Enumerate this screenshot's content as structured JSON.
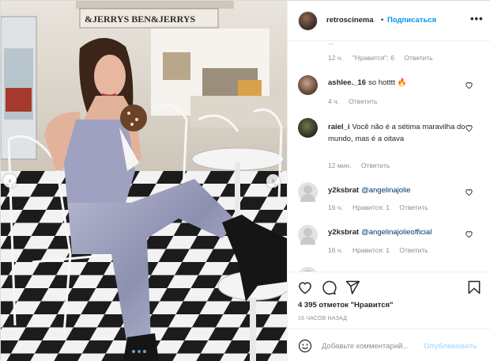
{
  "post": {
    "username": "retroscinema",
    "bullet": "•",
    "follow_label": "Подписаться",
    "more_label": "•••",
    "store_sign": "&JERRYS  BEN&JERRYS",
    "carousel": {
      "dots": 3,
      "active_dot": 1
    }
  },
  "comments": {
    "first": {
      "partial_text": "...",
      "time": "12 ч.",
      "likes": "\"Нравится\": 6",
      "reply_label": "Ответить"
    },
    "items": [
      {
        "user": "ashlee._16",
        "text": "so hotttt 🔥",
        "time": "4 ч.",
        "likes": "",
        "reply_label": "Ответить"
      },
      {
        "user": "raiel_i",
        "text": "Você não é a sétima maravilha do mundo, mas é a oitava",
        "time": "12 мин.",
        "likes": "",
        "reply_label": "Ответить"
      },
      {
        "user": "y2ksbrat",
        "text": "@angelinajolie",
        "time": "16 ч.",
        "likes": "Нравится: 1",
        "reply_label": "Ответить"
      },
      {
        "user": "y2ksbrat",
        "text": "@angelinajolieofficial",
        "time": "16 ч.",
        "likes": "Нравится: 1",
        "reply_label": "Ответить"
      }
    ]
  },
  "stats": {
    "likes_text": "4 395 отметок \"Нравится\"",
    "posted": "16 ЧАСОВ НАЗАД"
  },
  "add_comment": {
    "placeholder": "Добавьте комментарий...",
    "publish_label": "Опубликовать"
  },
  "colors": {
    "accent": "#0095f6",
    "publish_disabled": "#b2dffc",
    "muted": "#8e8e8e",
    "mention": "#00376b"
  }
}
